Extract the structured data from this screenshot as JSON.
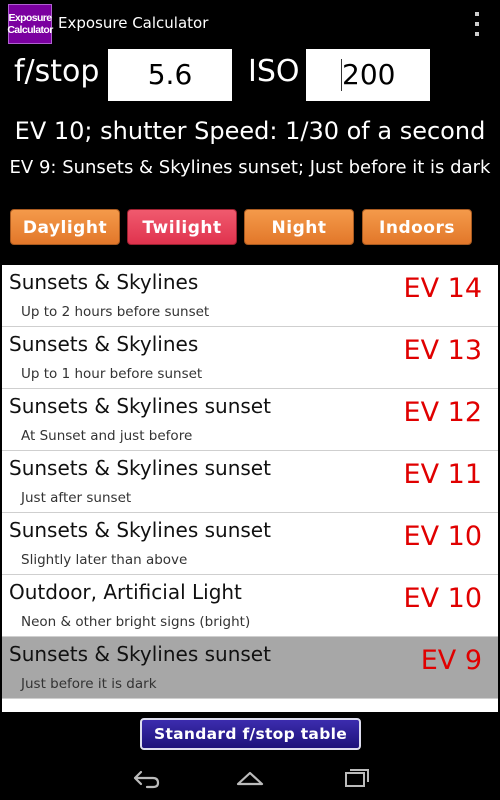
{
  "app": {
    "icon_line1": "Exposure",
    "icon_line2": "Calculator",
    "title": "Exposure Calculator"
  },
  "inputs": {
    "fstop_label": "f/stop",
    "fstop_value": "5.6",
    "iso_label": "ISO",
    "iso_value": "200"
  },
  "result": {
    "ev_line": "EV 10; shutter Speed: 1/30 of a second",
    "scene_line": "EV 9: Sunsets & Skylines sunset; Just before it is dark"
  },
  "categories": [
    {
      "label": "Daylight"
    },
    {
      "label": "Twilight"
    },
    {
      "label": "Night"
    },
    {
      "label": "Indoors"
    }
  ],
  "scenes": [
    {
      "title": "Sunsets & Skylines",
      "subtitle": "Up to 2 hours before sunset",
      "ev": "EV 14"
    },
    {
      "title": "Sunsets & Skylines",
      "subtitle": "Up to 1 hour before sunset",
      "ev": "EV 13"
    },
    {
      "title": "Sunsets & Skylines sunset",
      "subtitle": "At Sunset and just before",
      "ev": "EV 12"
    },
    {
      "title": "Sunsets & Skylines sunset",
      "subtitle": "Just after sunset",
      "ev": "EV 11"
    },
    {
      "title": "Sunsets & Skylines sunset",
      "subtitle": "Slightly later than above",
      "ev": "EV 10"
    },
    {
      "title": "Outdoor, Artificial Light",
      "subtitle": "Neon & other bright signs (bright)",
      "ev": "EV 10"
    },
    {
      "title": "Sunsets & Skylines sunset",
      "subtitle": "Just before it is dark",
      "ev": "EV 9"
    }
  ],
  "footer": {
    "standard_table_label": "Standard f/stop table"
  },
  "colors": {
    "orange_button": "#e98a3c",
    "selected_category": "#e8445c",
    "ev_text": "#e00000",
    "selected_row": "#a7a7a7",
    "standard_button": "#2a1c94"
  },
  "icons": {
    "overflow": "overflow-menu-icon",
    "back": "back-icon",
    "home": "home-icon",
    "recents": "recent-apps-icon"
  }
}
